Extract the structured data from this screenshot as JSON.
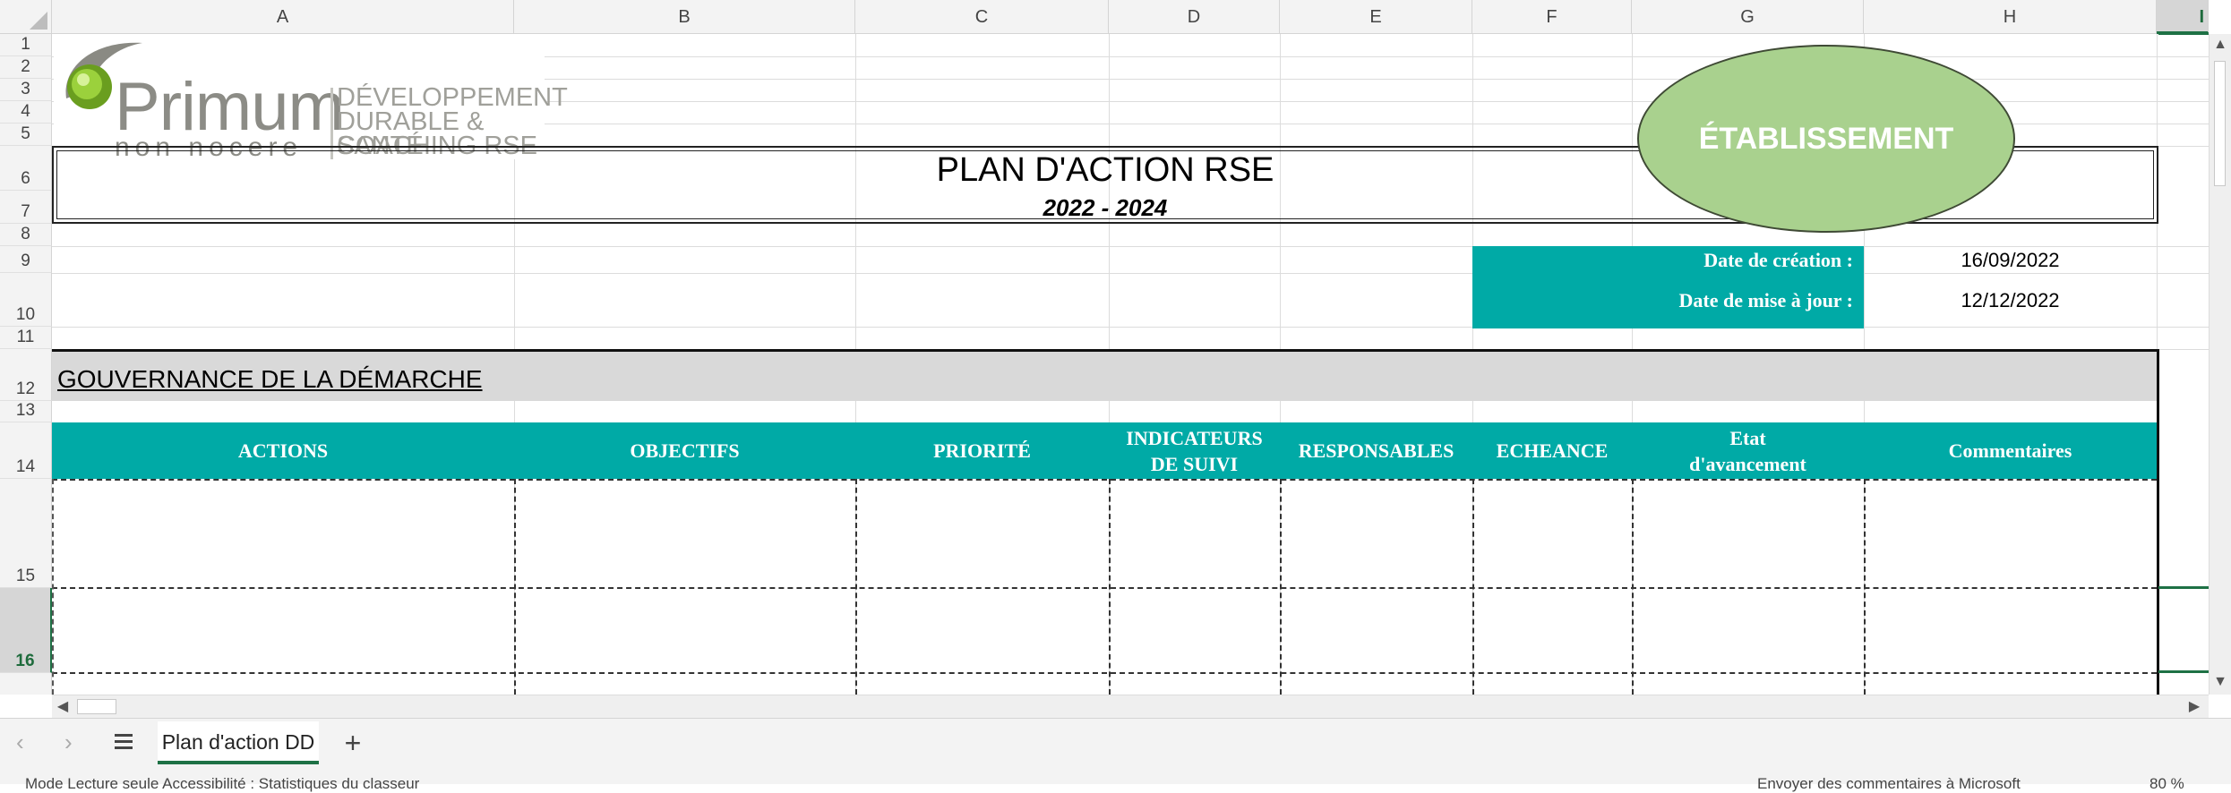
{
  "sheet": {
    "columns": [
      "A",
      "B",
      "C",
      "D",
      "E",
      "F",
      "G",
      "H",
      "I"
    ],
    "rows": [
      "1",
      "2",
      "3",
      "4",
      "5",
      "6",
      "7",
      "8",
      "9",
      "10",
      "11",
      "12",
      "13",
      "14",
      "15",
      "16"
    ],
    "selected_row": "16"
  },
  "logo": {
    "brand": "Primum",
    "tagline": "non nocere",
    "line1": "DÉVELOPPEMENT",
    "line2": "DURABLE & SANTÉ",
    "line3": "COACHING RSE"
  },
  "header": {
    "title": "PLAN D'ACTION RSE",
    "subtitle": "2022 - 2024",
    "badge": "ÉTABLISSEMENT"
  },
  "dates": {
    "creation_label": "Date de création :",
    "creation_value": "16/09/2022",
    "update_label": "Date de mise à jour :",
    "update_value": "12/12/2022"
  },
  "section": {
    "title": "GOUVERNANCE DE LA DÉMARCHE"
  },
  "table": {
    "headers": [
      "ACTIONS",
      "OBJECTIFS",
      "PRIORITÉ",
      "INDICATEURS DE SUIVI",
      "RESPONSABLES",
      "ECHEANCE",
      "Etat d'avancement",
      "Commentaires"
    ]
  },
  "tabs": {
    "active": "Plan d'action DD",
    "add": "+"
  },
  "status": {
    "left": "Mode Lecture seule  Accessibilité : Statistiques du classeur",
    "right": "Envoyer des commentaires à Microsoft",
    "zoom": "80 %"
  },
  "colors": {
    "accent_teal": "#00aaa6",
    "oval_green": "#a9d18e",
    "section_gray": "#d9d9d9",
    "excel_green": "#1e7145"
  }
}
